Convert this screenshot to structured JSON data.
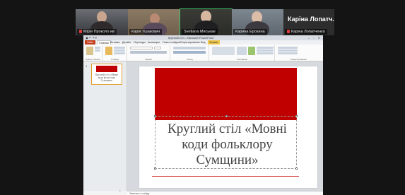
{
  "participants": [
    {
      "name": "Мірія Проколо ив",
      "muted": true
    },
    {
      "name": "Карія Ушакович",
      "muted": false
    },
    {
      "name": "Svetlana Миськае",
      "muted": false
    },
    {
      "name": "Карина Ерохина",
      "muted": false
    },
    {
      "name": "Каріна Лопатченко",
      "muted": true,
      "big_name": "Каріна Лопатч..."
    }
  ],
  "window": {
    "title": "Круглий стіл - Microsoft PowerPoint",
    "quick_access": "▣ ↶ ↷ ▾",
    "controls": "– ▫ ✕",
    "tabs": [
      "Файл",
      "Главная",
      "Вставка",
      "Дизайн",
      "Переходы",
      "Анимация",
      "Показ слайдов",
      "Рецензирование",
      "Вид",
      "Формат"
    ]
  },
  "ribbon_groups": [
    "Буфер обмена",
    "Слайды",
    "Шрифт",
    "Абзац",
    "Рисование",
    "Редактирование"
  ],
  "slides_pane": {
    "slide_number": "1",
    "thumb_text": "Круглий стіл «Мовні коди фольклору Сумщини»"
  },
  "slide": {
    "title": "Круглий стіл «Мовні коди фольклору Сумщини»"
  },
  "notes_placeholder": "Заметки к слайду",
  "colors": {
    "accent_red": "#c00000",
    "file_tab": "#c43e1c",
    "background": "#141414"
  }
}
